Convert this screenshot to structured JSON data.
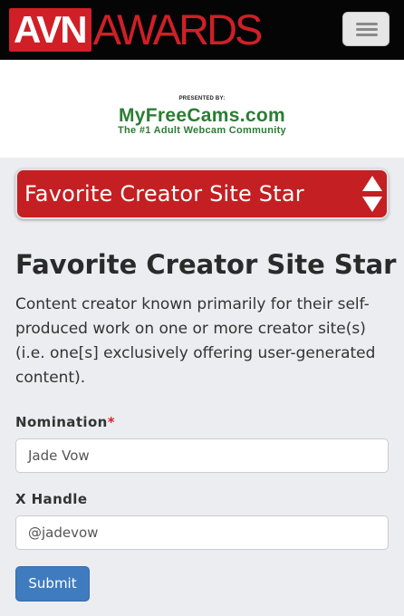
{
  "header": {
    "logo_avn": "AVN",
    "logo_awards": "AWARDS",
    "menu_icon": "hamburger-menu-icon"
  },
  "sponsor": {
    "presented_by": "PRESENTED BY:",
    "brand": "MyFreeCams.com",
    "tagline": "The #1 Adult Webcam Community",
    "brand_color": "#2c7c34"
  },
  "category_select": {
    "selected": "Favorite Creator Site Star",
    "icon": "up-down-arrows-icon",
    "color": "#c41f22"
  },
  "category": {
    "title": "Favorite Creator Site Star",
    "description": "Content creator known primarily for their self-produced work on one or more creator site(s) (i.e. one[s] exclusively offering user-generated content)."
  },
  "form": {
    "nomination_label": "Nomination",
    "required_marker": "*",
    "nomination_value": "Jade Vow",
    "x_handle_label": "X Handle",
    "x_handle_value": "@jadevow",
    "submit_label": "Submit",
    "submit_color": "#3f7cbf"
  }
}
